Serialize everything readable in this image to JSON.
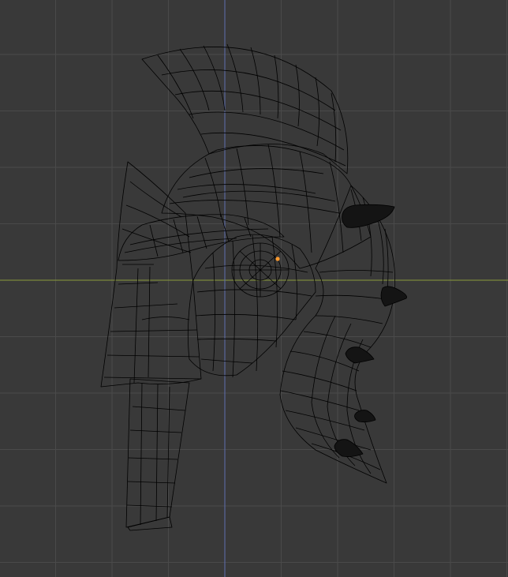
{
  "viewport": {
    "background_color": "#393939",
    "grid_color": "#4a4a4a",
    "x_axis_color": "#8a9a3a",
    "z_axis_color": "#5f6fb0",
    "grid_visible": true
  },
  "object": {
    "type": "helmet",
    "display_mode": "wireframe",
    "wire_color": "#000000",
    "spike_color": "#141414",
    "origin_color": "#ff9a2e"
  }
}
